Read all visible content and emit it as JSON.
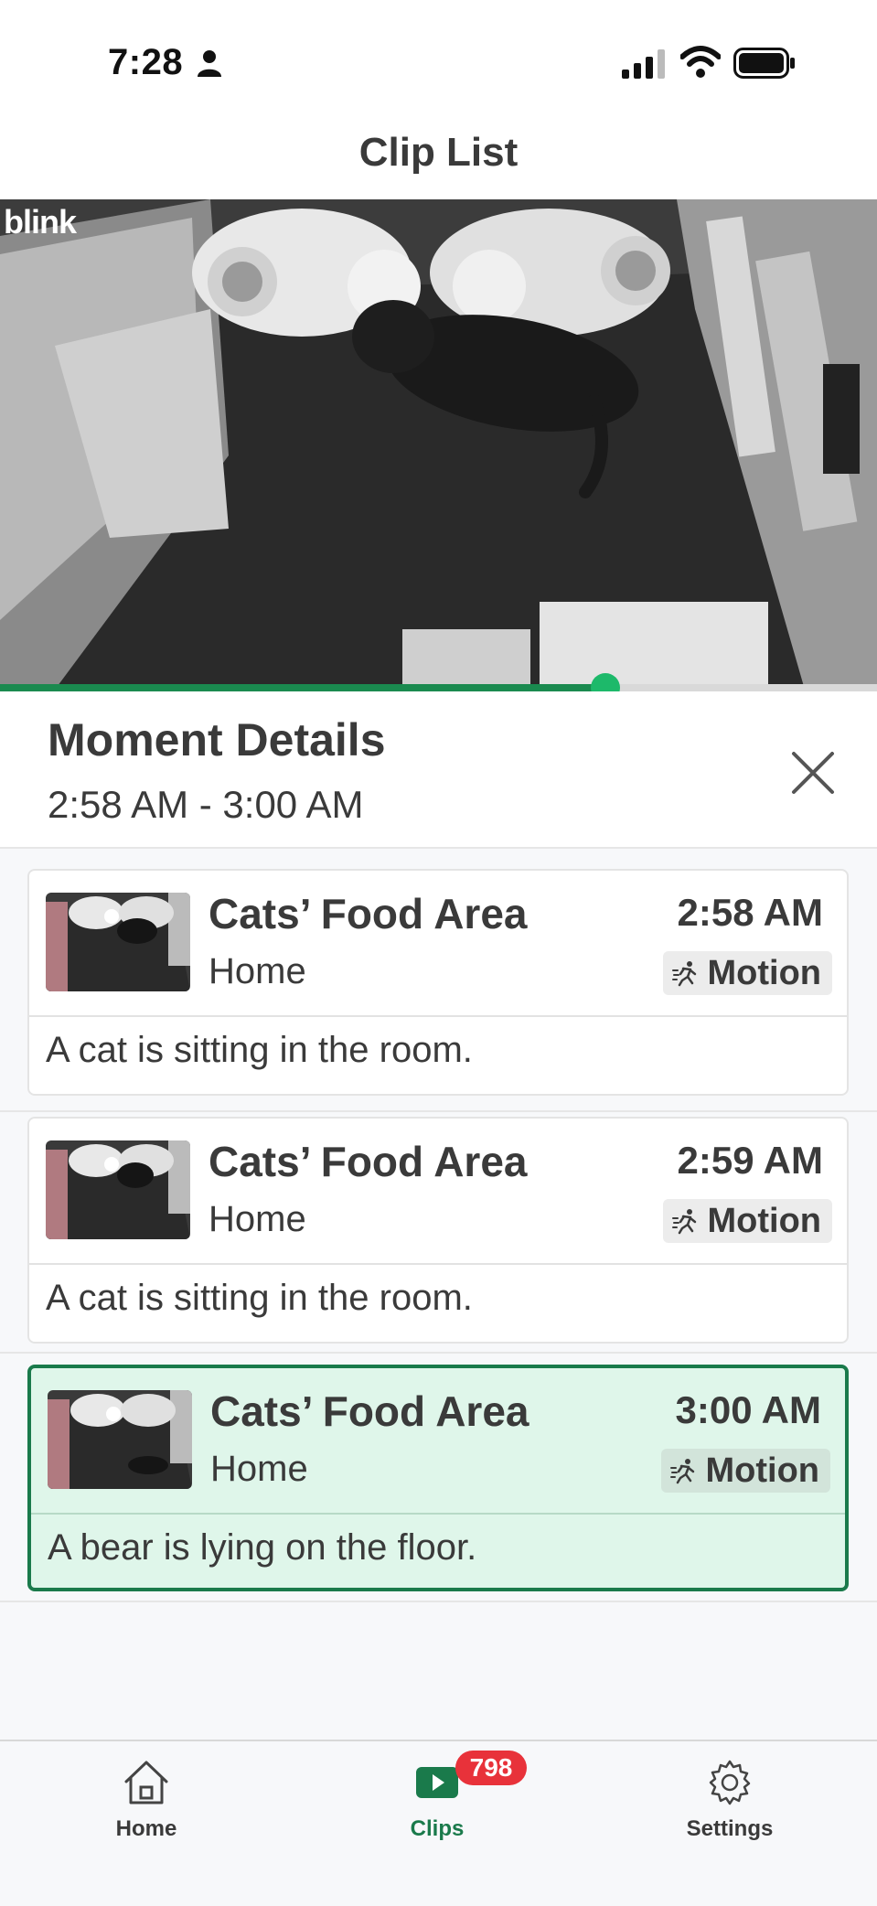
{
  "status_bar": {
    "time": "7:28"
  },
  "header": {
    "title": "Clip List"
  },
  "video": {
    "watermark": "blink",
    "playback_progress_percent": 69
  },
  "moment_details": {
    "title": "Moment Details",
    "time_range": "2:58 AM - 3:00 AM"
  },
  "clips": [
    {
      "camera_name": "Cats’ Food Area",
      "location": "Home",
      "time": "2:58 AM",
      "event_type": "Motion",
      "description": "A cat is sitting in the room.",
      "selected": false
    },
    {
      "camera_name": "Cats’ Food Area",
      "location": "Home",
      "time": "2:59 AM",
      "event_type": "Motion",
      "description": "A cat is sitting in the room.",
      "selected": false
    },
    {
      "camera_name": "Cats’ Food Area",
      "location": "Home",
      "time": "3:00 AM",
      "event_type": "Motion",
      "description": "A bear is lying on the floor.",
      "selected": true
    }
  ],
  "tabbar": {
    "home_label": "Home",
    "clips_label": "Clips",
    "clips_badge": "798",
    "settings_label": "Settings"
  },
  "colors": {
    "accent_green": "#1a7a4b",
    "selected_card_bg": "#dff6ea",
    "badge_red": "#e8323a"
  },
  "icons": [
    "person-icon",
    "signal-icon",
    "wifi-icon",
    "battery-icon",
    "close-icon",
    "motion-icon",
    "home-icon",
    "clips-play-icon",
    "settings-gear-icon"
  ]
}
